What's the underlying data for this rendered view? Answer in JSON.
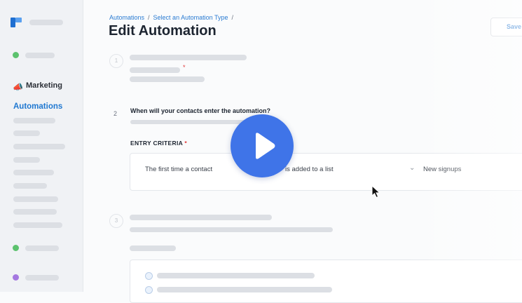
{
  "sidebar": {
    "marketing_label": "Marketing",
    "automations_label": "Automations",
    "accent_green": "#5cc26e",
    "accent_purple": "#a478e0"
  },
  "breadcrumb": {
    "item1": "Automations",
    "item2": "Select an Automation Type",
    "sep": "/"
  },
  "page": {
    "title": "Edit Automation",
    "save_label": "Save"
  },
  "step1": {
    "number": "1",
    "required_mark": "*"
  },
  "step2": {
    "number": "2",
    "question": "When will your contacts enter the automation?",
    "entry_label": "ENTRY CRITERIA",
    "required_mark": "*",
    "trigger": "The first time a contact",
    "action": "is added to a list",
    "list": "New signups"
  },
  "step3": {
    "number": "3"
  },
  "video": {
    "play_icon": "play-icon",
    "color": "#3f74e8"
  }
}
